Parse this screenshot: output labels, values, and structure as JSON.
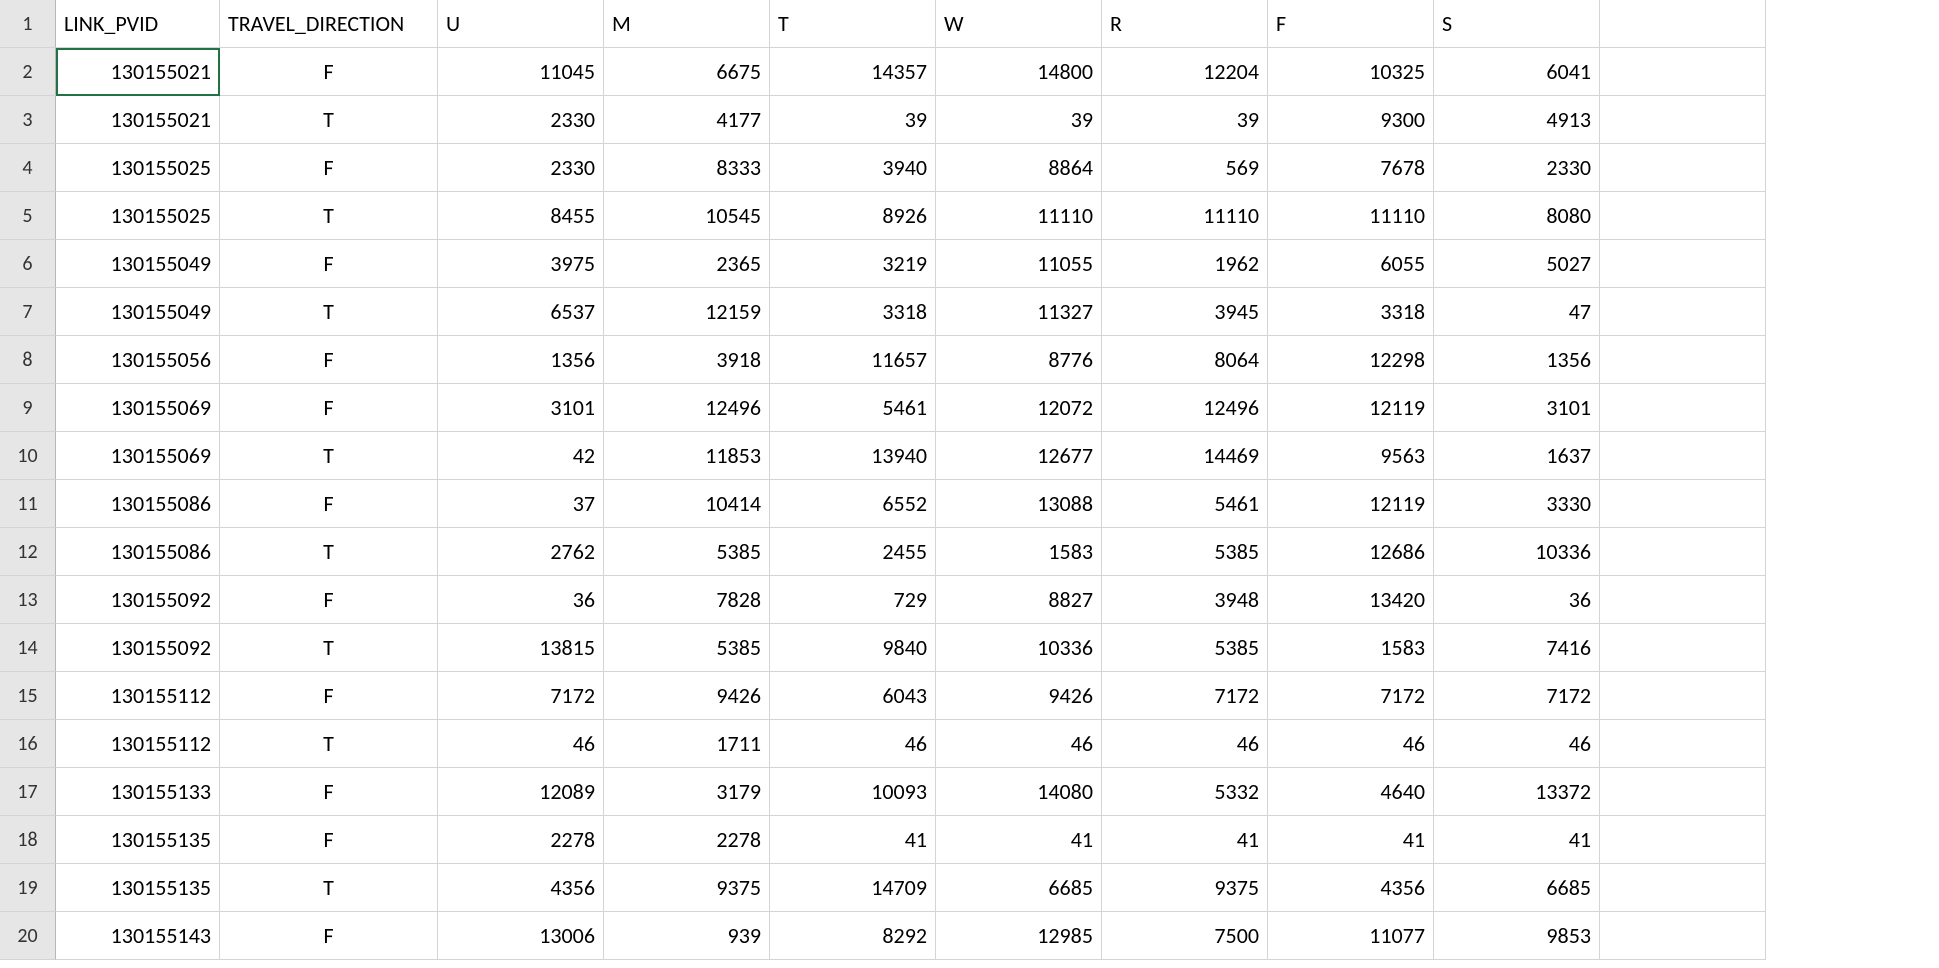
{
  "columns": [
    "LINK_PVID",
    "TRAVEL_DIRECTION",
    "U",
    "M",
    "T",
    "W",
    "R",
    "F",
    "S"
  ],
  "rows": [
    {
      "LINK_PVID": "130155021",
      "TRAVEL_DIRECTION": "F",
      "U": "11045",
      "M": "6675",
      "T": "14357",
      "W": "14800",
      "R": "12204",
      "F": "10325",
      "S": "6041"
    },
    {
      "LINK_PVID": "130155021",
      "TRAVEL_DIRECTION": "T",
      "U": "2330",
      "M": "4177",
      "T": "39",
      "W": "39",
      "R": "39",
      "F": "9300",
      "S": "4913"
    },
    {
      "LINK_PVID": "130155025",
      "TRAVEL_DIRECTION": "F",
      "U": "2330",
      "M": "8333",
      "T": "3940",
      "W": "8864",
      "R": "569",
      "F": "7678",
      "S": "2330"
    },
    {
      "LINK_PVID": "130155025",
      "TRAVEL_DIRECTION": "T",
      "U": "8455",
      "M": "10545",
      "T": "8926",
      "W": "11110",
      "R": "11110",
      "F": "11110",
      "S": "8080"
    },
    {
      "LINK_PVID": "130155049",
      "TRAVEL_DIRECTION": "F",
      "U": "3975",
      "M": "2365",
      "T": "3219",
      "W": "11055",
      "R": "1962",
      "F": "6055",
      "S": "5027"
    },
    {
      "LINK_PVID": "130155049",
      "TRAVEL_DIRECTION": "T",
      "U": "6537",
      "M": "12159",
      "T": "3318",
      "W": "11327",
      "R": "3945",
      "F": "3318",
      "S": "47"
    },
    {
      "LINK_PVID": "130155056",
      "TRAVEL_DIRECTION": "F",
      "U": "1356",
      "M": "3918",
      "T": "11657",
      "W": "8776",
      "R": "8064",
      "F": "12298",
      "S": "1356"
    },
    {
      "LINK_PVID": "130155069",
      "TRAVEL_DIRECTION": "F",
      "U": "3101",
      "M": "12496",
      "T": "5461",
      "W": "12072",
      "R": "12496",
      "F": "12119",
      "S": "3101"
    },
    {
      "LINK_PVID": "130155069",
      "TRAVEL_DIRECTION": "T",
      "U": "42",
      "M": "11853",
      "T": "13940",
      "W": "12677",
      "R": "14469",
      "F": "9563",
      "S": "1637"
    },
    {
      "LINK_PVID": "130155086",
      "TRAVEL_DIRECTION": "F",
      "U": "37",
      "M": "10414",
      "T": "6552",
      "W": "13088",
      "R": "5461",
      "F": "12119",
      "S": "3330"
    },
    {
      "LINK_PVID": "130155086",
      "TRAVEL_DIRECTION": "T",
      "U": "2762",
      "M": "5385",
      "T": "2455",
      "W": "1583",
      "R": "5385",
      "F": "12686",
      "S": "10336"
    },
    {
      "LINK_PVID": "130155092",
      "TRAVEL_DIRECTION": "F",
      "U": "36",
      "M": "7828",
      "T": "729",
      "W": "8827",
      "R": "3948",
      "F": "13420",
      "S": "36"
    },
    {
      "LINK_PVID": "130155092",
      "TRAVEL_DIRECTION": "T",
      "U": "13815",
      "M": "5385",
      "T": "9840",
      "W": "10336",
      "R": "5385",
      "F": "1583",
      "S": "7416"
    },
    {
      "LINK_PVID": "130155112",
      "TRAVEL_DIRECTION": "F",
      "U": "7172",
      "M": "9426",
      "T": "6043",
      "W": "9426",
      "R": "7172",
      "F": "7172",
      "S": "7172"
    },
    {
      "LINK_PVID": "130155112",
      "TRAVEL_DIRECTION": "T",
      "U": "46",
      "M": "1711",
      "T": "46",
      "W": "46",
      "R": "46",
      "F": "46",
      "S": "46"
    },
    {
      "LINK_PVID": "130155133",
      "TRAVEL_DIRECTION": "F",
      "U": "12089",
      "M": "3179",
      "T": "10093",
      "W": "14080",
      "R": "5332",
      "F": "4640",
      "S": "13372"
    },
    {
      "LINK_PVID": "130155135",
      "TRAVEL_DIRECTION": "F",
      "U": "2278",
      "M": "2278",
      "T": "41",
      "W": "41",
      "R": "41",
      "F": "41",
      "S": "41"
    },
    {
      "LINK_PVID": "130155135",
      "TRAVEL_DIRECTION": "T",
      "U": "4356",
      "M": "9375",
      "T": "14709",
      "W": "6685",
      "R": "9375",
      "F": "4356",
      "S": "6685"
    },
    {
      "LINK_PVID": "130155143",
      "TRAVEL_DIRECTION": "F",
      "U": "13006",
      "M": "939",
      "T": "8292",
      "W": "12985",
      "R": "7500",
      "F": "11077",
      "S": "9853"
    }
  ],
  "row_headers": [
    "1",
    "2",
    "3",
    "4",
    "5",
    "6",
    "7",
    "8",
    "9",
    "10",
    "11",
    "12",
    "13",
    "14",
    "15",
    "16",
    "17",
    "18",
    "19",
    "20"
  ],
  "selected_cell": "A2"
}
